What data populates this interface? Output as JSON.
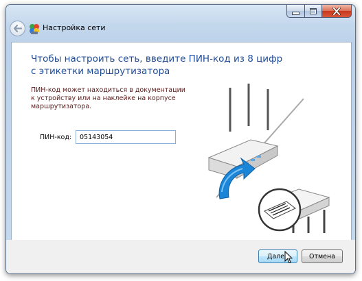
{
  "window": {
    "title": "Настройка сети"
  },
  "main": {
    "headline": "Чтобы настроить сеть, введите ПИН-код из 8 цифр с этикетки маршрутизатора",
    "description": "ПИН-код может находиться в документации к устройству или на наклейке на корпусе маршрутизатора.",
    "pin_label": "ПИН-код:",
    "pin_value": "05143054"
  },
  "footer": {
    "next_label": "Далее",
    "cancel_label": "Отмена"
  },
  "icons": {
    "back": "back-arrow-icon",
    "network": "network-setup-icon",
    "minimize": "minimize-icon",
    "maximize": "maximize-icon",
    "close": "close-icon",
    "cursor": "mouse-cursor-icon"
  },
  "colors": {
    "headline": "#1e4c96",
    "description": "#5a1a1a",
    "arrow": "#1b86d8"
  }
}
